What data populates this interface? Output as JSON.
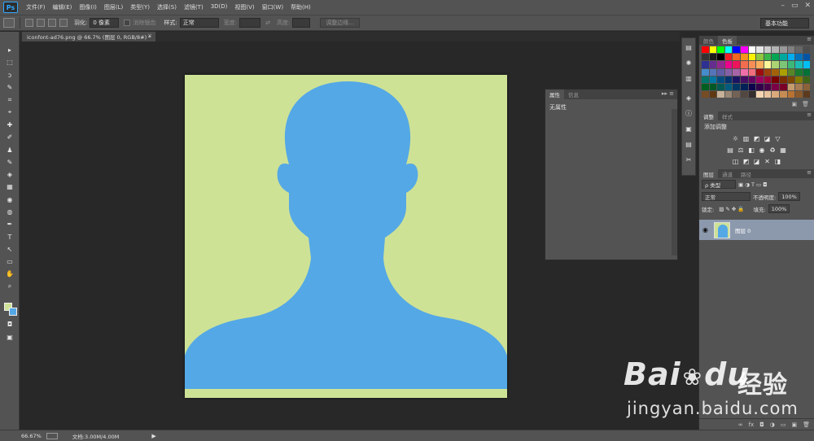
{
  "app": {
    "logo": "Ps"
  },
  "menu": [
    "文件(F)",
    "编辑(E)",
    "图像(I)",
    "图层(L)",
    "类型(Y)",
    "选择(S)",
    "滤镜(T)",
    "3D(D)",
    "视图(V)",
    "窗口(W)",
    "帮助(H)"
  ],
  "window_controls": {
    "minimize": "–",
    "restore": "▭",
    "close": "✕"
  },
  "options": {
    "feather_label": "羽化:",
    "feather_value": "0 像素",
    "antialias_label": "消除锯齿",
    "style_label": "样式:",
    "style_value": "正常",
    "width_label": "宽度:",
    "height_label": "高度:",
    "refine_edge": "调整边缘...",
    "workspace": "基本功能"
  },
  "document_tab": {
    "title": "iconfont-ad76.png @ 66.7% (图层 0, RGB/8#) *",
    "close": "×"
  },
  "properties_panel": {
    "tabs": [
      "属性",
      "信息"
    ],
    "content": "无属性"
  },
  "swatches_panel": {
    "tabs": [
      "颜色",
      "色板"
    ],
    "colors": [
      "#ff0000",
      "#ffff00",
      "#00ff00",
      "#00ffff",
      "#0000ff",
      "#ff00ff",
      "#ffffff",
      "#e6e6e6",
      "#cccccc",
      "#b3b3b3",
      "#999999",
      "#808080",
      "#666666",
      "#4d4d4d",
      "#333333",
      "#1a1a1a",
      "#000000",
      "#ed1c24",
      "#f26522",
      "#f7941d",
      "#fff200",
      "#8dc63f",
      "#39b54a",
      "#00a651",
      "#00a99d",
      "#00aeef",
      "#0072bc",
      "#0054a6",
      "#2e3192",
      "#662d91",
      "#92278f",
      "#ec008c",
      "#ed145b",
      "#f26c4f",
      "#f68e56",
      "#fbaf5d",
      "#fff799",
      "#acd373",
      "#7cc576",
      "#3bb878",
      "#1abbb4",
      "#00bff3",
      "#448ccb",
      "#5674b9",
      "#605ca8",
      "#8560a8",
      "#a864a8",
      "#f06eaa",
      "#f26d7d",
      "#9e0b0f",
      "#a0410d",
      "#a36209",
      "#aba000",
      "#598527",
      "#197b30",
      "#007236",
      "#00746b",
      "#0076a3",
      "#004b80",
      "#003471",
      "#1b1464",
      "#440e62",
      "#630460",
      "#9e005d",
      "#9e0039",
      "#790000",
      "#7b2e00",
      "#7d4900",
      "#827b00",
      "#406618",
      "#005e20",
      "#005826",
      "#005952",
      "#005b7f",
      "#003663",
      "#002157",
      "#0d004c",
      "#32004b",
      "#4b0049",
      "#7b0046",
      "#7a0026",
      "#c69c6d",
      "#a67c52",
      "#8c6239",
      "#754c24",
      "#603913",
      "#c7b299",
      "#998675",
      "#736357",
      "#534741",
      "#362f2d",
      "#f5d5b3",
      "#e8c39e",
      "#d9a97c",
      "#c68c53",
      "#b87333",
      "#8b5a2b",
      "#5c3a1e"
    ]
  },
  "adjustments_panel": {
    "tabs": [
      "调整",
      "样式"
    ],
    "title": "添加调整",
    "row1": [
      "☼",
      "▥",
      "◩",
      "◪",
      "▽"
    ],
    "row2": [
      "▤",
      "⚖",
      "◧",
      "◉",
      "♻",
      "▦"
    ],
    "row3": [
      "◫",
      "◩",
      "◪",
      "✕",
      "◨"
    ]
  },
  "layers_panel": {
    "tabs": [
      "图层",
      "通道",
      "路径"
    ],
    "filter_kind": "ρ 类型",
    "blend_mode": "正常",
    "opacity_label": "不透明度:",
    "opacity_value": "100%",
    "lock_label": "锁定:",
    "fill_label": "填充:",
    "fill_value": "100%",
    "layer_name": "图层 0",
    "footer_icons": [
      "∞",
      "fx",
      "◘",
      "◑",
      "▭",
      "▣",
      "🗑"
    ]
  },
  "toolbox": [
    "▸",
    "⬚",
    "ↄ",
    "✎",
    "⌗",
    "⌖",
    "✚",
    "✐",
    "♟",
    "✎",
    "◈",
    "▦",
    "◉",
    "◍",
    "✒",
    "T",
    "↖",
    "▭",
    "✋",
    "⌕"
  ],
  "status": {
    "zoom": "66.67%",
    "doc_info": "文档:3.00M/4.00M",
    "arrow": "▶"
  },
  "watermark": {
    "brand": "Bai",
    "brand_tail": "du",
    "cn": "经验",
    "url": "jingyan.baidu.com"
  },
  "colors": {
    "canvas_bg": "#cee296",
    "silhouette": "#54a8e6"
  }
}
